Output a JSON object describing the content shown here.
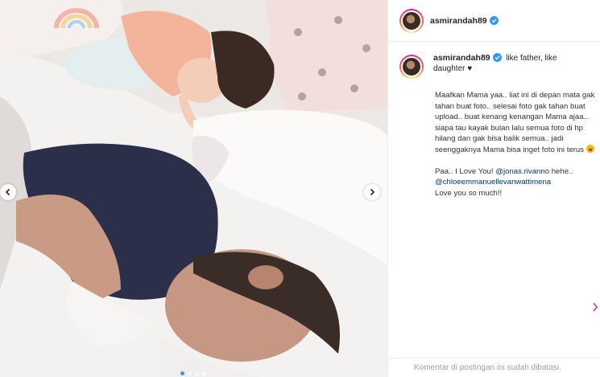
{
  "post": {
    "username": "asmirandah89",
    "verified": true,
    "caption_title": "like father, like daughter ♥",
    "caption_paragraphs": [
      "Maafkan Mama yaa.. liat ini di depan mata gak tahan buat foto.. selesai foto gak tahan buat upload.. buat kenang kenangan Mama ajaa.. siapa tau kayak bulan lalu semua foto di hp hilang dan gak bisa balik semua.. jadi seenggaknya Mama bisa inget foto ini terus"
    ],
    "love_prefix": "Paa.. I Love You!",
    "mention_1": "@jonas.rivanno",
    "mention_suffix": "hehe..",
    "mention_2": "@chloeemmanuellevanwattimena",
    "closing": "Love you so much!!",
    "comments_disabled_text": "Komentar di postingan ini sudah dibatasi.",
    "carousel": {
      "slides": 4,
      "current": 1
    },
    "colors": {
      "verified_blue": "#3897f0",
      "mention": "#00376b",
      "muted": "#9e9e9e"
    },
    "icons": [
      "verified-badge-icon",
      "chevron-left-icon",
      "chevron-right-icon",
      "emoji-icon"
    ]
  }
}
